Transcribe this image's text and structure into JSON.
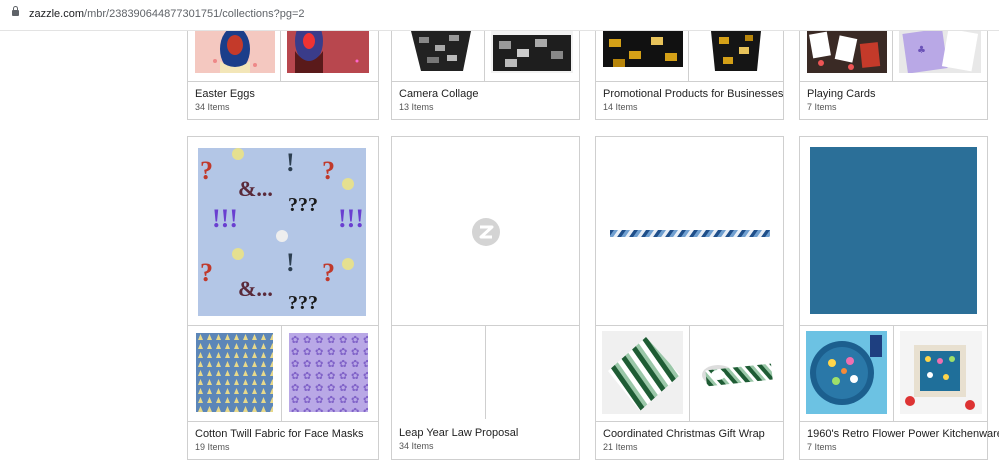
{
  "browser": {
    "url_domain": "zazzle.com",
    "url_path": "/mbr/238390644877301751/collections?pg=2"
  },
  "row1": [
    {
      "title": "Easter Eggs",
      "count": "34 Items"
    },
    {
      "title": "Camera Collage",
      "count": "13 Items"
    },
    {
      "title": "Promotional Products for Businesses",
      "count": "14 Items"
    },
    {
      "title": "Playing Cards",
      "count": "7 Items"
    }
  ],
  "row2": [
    {
      "title": "Cotton Twill Fabric for Face Masks",
      "count": "19 Items"
    },
    {
      "title": "Leap Year Law Proposal",
      "count": "34 Items"
    },
    {
      "title": "Coordinated Christmas Gift Wrap",
      "count": "21 Items"
    },
    {
      "title": "1960's Retro Flower Power Kitchenware",
      "count": "7 Items"
    }
  ],
  "fabric_text": {
    "q": "?",
    "amp": "&...",
    "bang": "!",
    "qqq": "???",
    "bbb": "!!!"
  },
  "colors": {
    "card_border": "#cfcfcf",
    "fabric_bg": "#b3c6e6",
    "teal_paper": "#2b6f98"
  }
}
